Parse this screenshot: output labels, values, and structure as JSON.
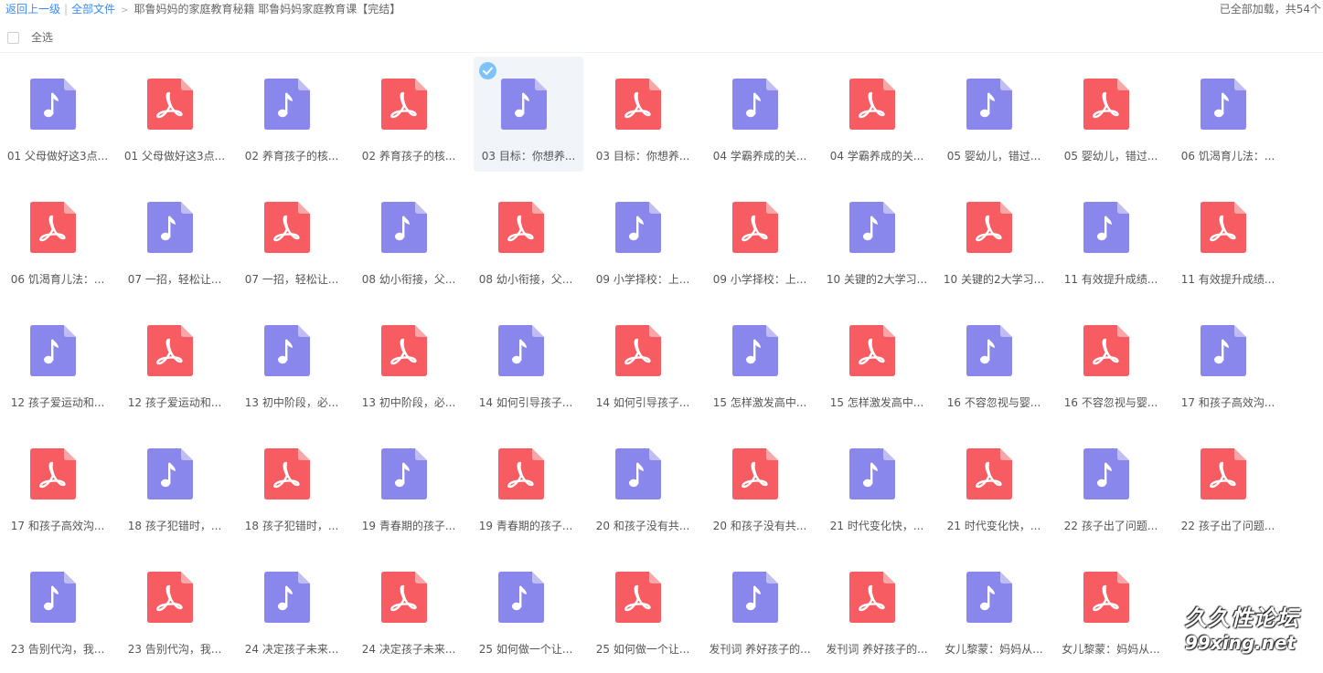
{
  "breadcrumb": {
    "back": "返回上一级",
    "separator": "|",
    "all_files": "全部文件",
    "arrow": ">",
    "current": "耶鲁妈妈的家庭教育秘籍 耶鲁妈妈家庭教育课【完结】"
  },
  "status": {
    "loaded": "已全部加载，共54个"
  },
  "select_all": {
    "label": "全选"
  },
  "colors": {
    "audio": "#8a87ec",
    "pdf": "#f65c61",
    "link": "#3b8cff",
    "check": "#7cc3f9"
  },
  "files": [
    {
      "name": "01 父母做好这3点...",
      "type": "audio"
    },
    {
      "name": "01 父母做好这3点...",
      "type": "pdf"
    },
    {
      "name": "02 养育孩子的核...",
      "type": "audio"
    },
    {
      "name": "02 养育孩子的核...",
      "type": "pdf"
    },
    {
      "name": "03 目标：你想养...",
      "type": "audio",
      "selected": true
    },
    {
      "name": "03 目标：你想养...",
      "type": "pdf"
    },
    {
      "name": "04 学霸养成的关...",
      "type": "audio"
    },
    {
      "name": "04 学霸养成的关...",
      "type": "pdf"
    },
    {
      "name": "05 婴幼儿，错过...",
      "type": "audio"
    },
    {
      "name": "05 婴幼儿，错过...",
      "type": "pdf"
    },
    {
      "name": "06 饥渴育儿法：...",
      "type": "audio"
    },
    {
      "name": "06 饥渴育儿法：...",
      "type": "pdf"
    },
    {
      "name": "07 一招，轻松让...",
      "type": "audio"
    },
    {
      "name": "07 一招，轻松让...",
      "type": "pdf"
    },
    {
      "name": "08 幼小衔接，父...",
      "type": "audio"
    },
    {
      "name": "08 幼小衔接，父...",
      "type": "pdf"
    },
    {
      "name": "09 小学择校：上...",
      "type": "audio"
    },
    {
      "name": "09 小学择校：上...",
      "type": "pdf"
    },
    {
      "name": "10 关键的2大学习...",
      "type": "audio"
    },
    {
      "name": "10 关键的2大学习...",
      "type": "pdf"
    },
    {
      "name": "11 有效提升成绩...",
      "type": "audio"
    },
    {
      "name": "11 有效提升成绩...",
      "type": "pdf"
    },
    {
      "name": "12 孩子爱运动和...",
      "type": "audio"
    },
    {
      "name": "12 孩子爱运动和...",
      "type": "pdf"
    },
    {
      "name": "13 初中阶段，必...",
      "type": "audio"
    },
    {
      "name": "13 初中阶段，必...",
      "type": "pdf"
    },
    {
      "name": "14 如何引导孩子...",
      "type": "audio"
    },
    {
      "name": "14 如何引导孩子...",
      "type": "pdf"
    },
    {
      "name": "15 怎样激发高中...",
      "type": "audio"
    },
    {
      "name": "15 怎样激发高中...",
      "type": "pdf"
    },
    {
      "name": "16 不容忽视与婴...",
      "type": "audio"
    },
    {
      "name": "16 不容忽视与婴...",
      "type": "pdf"
    },
    {
      "name": "17 和孩子高效沟...",
      "type": "audio"
    },
    {
      "name": "17 和孩子高效沟...",
      "type": "pdf"
    },
    {
      "name": "18 孩子犯错时，...",
      "type": "audio"
    },
    {
      "name": "18 孩子犯错时，...",
      "type": "pdf"
    },
    {
      "name": "19 青春期的孩子...",
      "type": "audio"
    },
    {
      "name": "19 青春期的孩子...",
      "type": "pdf"
    },
    {
      "name": "20 和孩子没有共...",
      "type": "audio"
    },
    {
      "name": "20 和孩子没有共...",
      "type": "pdf"
    },
    {
      "name": "21 时代变化快，...",
      "type": "audio"
    },
    {
      "name": "21 时代变化快，...",
      "type": "pdf"
    },
    {
      "name": "22 孩子出了问题...",
      "type": "audio"
    },
    {
      "name": "22 孩子出了问题...",
      "type": "pdf"
    },
    {
      "name": "23 告别代沟，我...",
      "type": "audio"
    },
    {
      "name": "23 告别代沟，我...",
      "type": "pdf"
    },
    {
      "name": "24 决定孩子未来...",
      "type": "audio"
    },
    {
      "name": "24 决定孩子未来...",
      "type": "pdf"
    },
    {
      "name": "25 如何做一个让...",
      "type": "audio"
    },
    {
      "name": "25 如何做一个让...",
      "type": "pdf"
    },
    {
      "name": "发刊词 养好孩子的...",
      "type": "audio"
    },
    {
      "name": "发刊词 养好孩子的...",
      "type": "pdf"
    },
    {
      "name": "女儿黎蒙：妈妈从...",
      "type": "audio"
    },
    {
      "name": "女儿黎蒙：妈妈从...",
      "type": "pdf"
    }
  ],
  "watermark": {
    "line1": "久久性论坛",
    "line2": "99xing.net"
  }
}
